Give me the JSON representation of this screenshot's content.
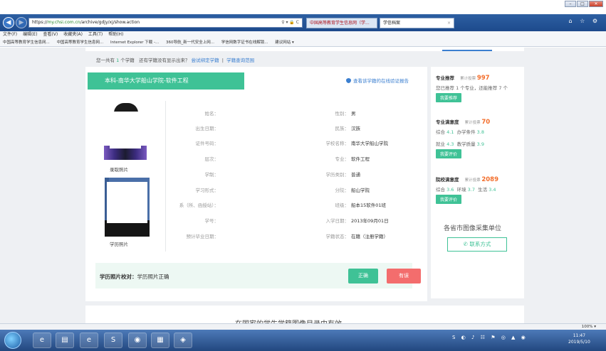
{
  "browser": {
    "url_prefix": "https://",
    "url_host": "my.chsi.com.cn",
    "url_path": "/archive/gdjy/xj/show.action",
    "url_controls": "♀ ▾ 🔒 C",
    "tab1": "中国高等教育学生信息网（学...",
    "tab2": "学信档案",
    "tab_close": "×",
    "right_icons": "⌂ ☆ ⚙",
    "menu": [
      "文件(F)",
      "编辑(E)",
      "查看(V)",
      "收藏夹(A)",
      "工具(T)",
      "帮助(H)"
    ],
    "favorites": [
      "中国高等教育学生信息网...",
      "中国高等教育学生信息网...",
      "Internet Explorer 下载 -...",
      "360导航_新一代安全上网...",
      "学信网数字证书在线解锁...",
      "建议网站 ▾"
    ]
  },
  "page": {
    "count_prefix": "您一共有",
    "count_num": "1",
    "count_suffix": "个学籍",
    "count_q": "还有学籍没有显示出来？",
    "count_link1": "尝试绑定学籍",
    "count_sep": "|",
    "count_link2": "学籍查询范围",
    "header": "本科-南华大学船山学院-软件工程",
    "verify": "查看该学籍的在线验证报告",
    "photo1_caption": "录取照片",
    "photo2_caption": "学历照片",
    "fields_left": [
      {
        "label": "姓名：",
        "value": ""
      },
      {
        "label": "出生日期：",
        "value": ""
      },
      {
        "label": "证件号码：",
        "value": ""
      },
      {
        "label": "层次：",
        "value": ""
      },
      {
        "label": "学制：",
        "value": ""
      },
      {
        "label": "学习形式：",
        "value": ""
      },
      {
        "label": "系（所、函授站）：",
        "value": ""
      },
      {
        "label": "学号：",
        "value": ""
      },
      {
        "label": "预计毕业日期：",
        "value": ""
      }
    ],
    "fields_right": [
      {
        "label": "性别：",
        "value": "男"
      },
      {
        "label": "民族：",
        "value": "汉族"
      },
      {
        "label": "学校名称：",
        "value": "南华大学船山学院"
      },
      {
        "label": "专业：",
        "value": "软件工程"
      },
      {
        "label": "学历类别：",
        "value": "普通"
      },
      {
        "label": "分院：",
        "value": "船山学院"
      },
      {
        "label": "班级：",
        "value": "船本15软件01班"
      },
      {
        "label": "入学日期：",
        "value": "2013年09月01日"
      },
      {
        "label": "学籍状态：",
        "value": "在籍（注册学籍）"
      }
    ],
    "correction_label": "学历照片校对：",
    "correction_value": "学历照片正确",
    "btn_ok": "正确",
    "btn_err": "有误"
  },
  "sidebar": {
    "rec_title": "专业推荐",
    "rec_cnt_label": "累计投票",
    "rec_cnt": "997",
    "rec_line": "您已推荐 1 个专业，还能推荐 7 个",
    "rec_btn": "我要推荐",
    "sat_title": "专业满意度",
    "sat_cnt_label": "累计投票",
    "sat_cnt": "70",
    "sat_l1a": "综合",
    "sat_v1a": "4.1",
    "sat_l1b": "办学条件",
    "sat_v1b": "3.8",
    "sat_l2a": "就业",
    "sat_v2a": "4.3",
    "sat_l2b": "教学质量",
    "sat_v2b": "3.9",
    "sat_btn": "我要评价",
    "sch_title": "院校满意度",
    "sch_cnt_label": "累计投票",
    "sch_cnt": "2089",
    "sch_l1": "综合",
    "sch_v1": "3.6",
    "sch_l2": "环境",
    "sch_v2": "3.7",
    "sch_l3": "生活",
    "sch_v3": "3.4",
    "sch_btn": "我要评价",
    "collect": "各省市图像采集单位",
    "contact": "联系方式"
  },
  "bottom_text": "在国家的学生学籍图像目录中有效",
  "zoom": "100%",
  "zoom_arrow": "▾",
  "clock_time": "11:47",
  "clock_date": "2019/5/10",
  "window_controls": [
    "–",
    "□",
    "✕"
  ],
  "nav_back": "◀",
  "nav_forward": "▶",
  "tray_icons": "S ◐ ♪ ☷ ⚑ ◎ ▲ ◉",
  "taskbar_apps": [
    "e",
    "▤",
    "e",
    "S",
    "◉",
    "▦",
    "◈"
  ]
}
